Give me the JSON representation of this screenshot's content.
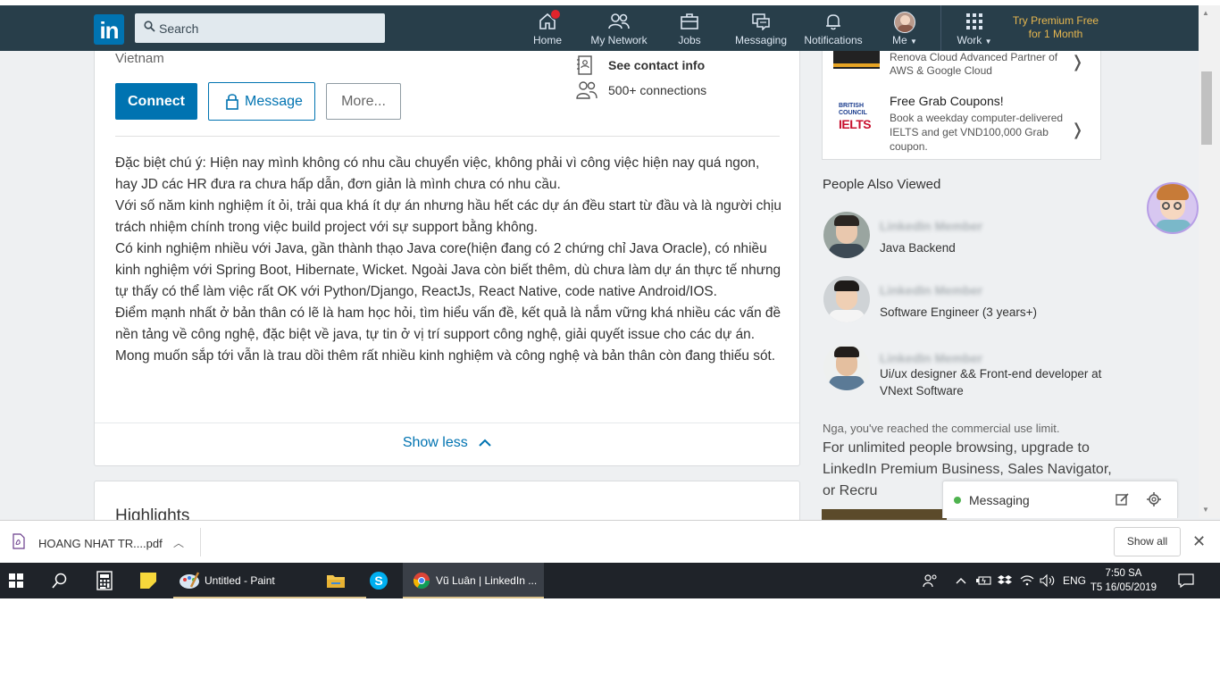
{
  "navbar": {
    "search_placeholder": "Search",
    "items": [
      {
        "label": "Home",
        "icon": "home-icon"
      },
      {
        "label": "My Network",
        "icon": "people-icon"
      },
      {
        "label": "Jobs",
        "icon": "briefcase-icon"
      },
      {
        "label": "Messaging",
        "icon": "chat-icon"
      },
      {
        "label": "Notifications",
        "icon": "bell-icon"
      },
      {
        "label": "Me",
        "icon": "avatar"
      },
      {
        "label": "Work",
        "icon": "grid-icon"
      }
    ],
    "premium_line1": "Try Premium Free",
    "premium_line2": "for 1 Month",
    "colors": {
      "bar": "#283e4a",
      "brand": "#0073b1",
      "premium": "#e7b74f"
    }
  },
  "profile": {
    "location": "Vietnam",
    "connect_label": "Connect",
    "message_label": "Message",
    "more_label": "More...",
    "contact_info": "See contact info",
    "connections": "500+ connections",
    "summary": [
      "Đặc biệt chú ý: Hiện nay mình không có nhu cầu chuyển việc, không phải vì công việc hiện nay quá ngon, hay JD các HR đưa ra chưa hấp dẫn, đơn giản là mình chưa có nhu cầu.",
      "Với số năm kinh nghiệm ít ỏi, trải qua khá ít dự án nhưng hầu hết các dự án đều start từ đầu và là người chịu trách nhiệm chính trong việc build project với sự support bằng không.",
      "Có kinh nghiệm nhiều với Java, gần thành thạo Java core(hiện đang có 2 chứng chỉ Java Oracle), có nhiều kinh nghiệm với Spring Boot, Hibernate, Wicket. Ngoài Java còn biết thêm, dù chưa làm dự án thực tế nhưng tự thấy có thể làm việc rất OK với Python/Django, ReactJs, React Native, code native Android/IOS.",
      "Điểm mạnh nhất ở bản thân có lẽ là ham học hỏi, tìm hiểu vấn đề, kết quả là nắm vững khá nhiều các vấn đề nền tảng về công nghệ, đặc biệt về java, tự tin ở vị trí support công nghệ, giải quyết issue cho các dự án.",
      "Mong muốn sắp tới vẫn là trau dồi thêm rất nhiều kinh nghiệm và công nghệ và bản thân còn đang thiếu sót."
    ],
    "show_less": "Show less",
    "highlights": "Highlights"
  },
  "ads": {
    "ad1_text": "Renova Cloud Advanced Partner of AWS & Google Cloud",
    "ad2_logo_line1": "BRITISH",
    "ad2_logo_line2": "COUNCIL",
    "ad2_logo_main": "IELTS",
    "ad2_title": "Free Grab Coupons!",
    "ad2_text": "Book a weekday computer-delivered IELTS and get VND100,000 Grab coupon."
  },
  "people_also_viewed": {
    "title": "People Also Viewed",
    "people": [
      {
        "name": "LinkedIn Member",
        "headline": "Java Backend"
      },
      {
        "name": "LinkedIn Member",
        "headline": "Software Engineer (3 years+)"
      },
      {
        "name": "LinkedIn Member",
        "headline": "Ui/ux designer && Front-end developer at VNext Software"
      }
    ]
  },
  "limit": {
    "small": "Nga, you've reached the commercial use limit.",
    "big": "For unlimited people browsing, upgrade to LinkedIn Premium Business, Sales Navigator, or Recru"
  },
  "messaging": {
    "label": "Messaging"
  },
  "downloads": {
    "file_name": "HOANG NHAT TR....pdf",
    "show_all": "Show all"
  },
  "taskbar": {
    "apps": [
      {
        "label": "Untitled - Paint",
        "icon": "paint-icon"
      },
      {
        "label": "Vũ Luân | LinkedIn ...",
        "icon": "chrome-icon"
      }
    ],
    "language": "ENG",
    "time": "7:50 SA",
    "date": "T5 16/05/2019"
  }
}
